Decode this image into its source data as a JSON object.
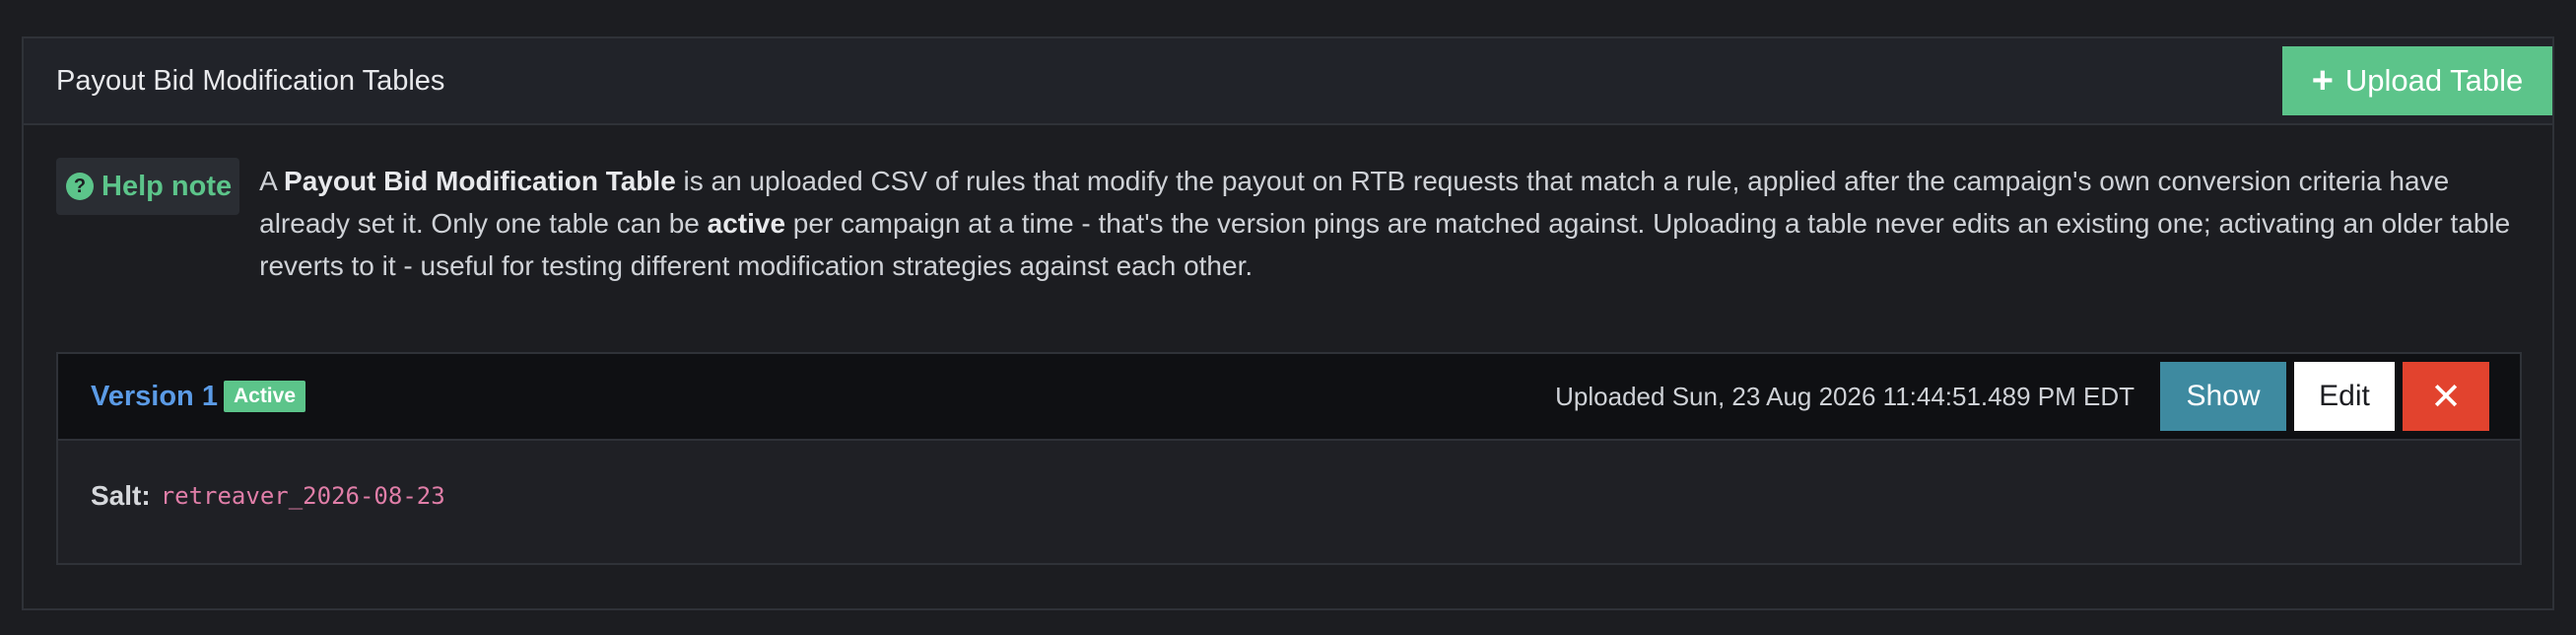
{
  "panel": {
    "title": "Payout Bid Modification Tables",
    "upload_label": "Upload Table",
    "upload_icon": "plus-icon"
  },
  "help": {
    "badge_label": "Help note",
    "badge_icon": "question-circle-icon",
    "text_parts": {
      "p1": "A ",
      "b1": "Payout Bid Modification Table",
      "p2": " is an uploaded CSV of rules that modify the payout on RTB requests that match a rule, applied after the campaign's own conversion criteria have already set it. Only one table can be ",
      "b2": "active",
      "p3": " per campaign at a time - that's the version pings are matched against. Uploading a table never edits an existing one; activating an older table reverts to it - useful for testing different modification strategies against each other."
    }
  },
  "version": {
    "title": "Version 1",
    "badge": "Active",
    "uploaded": "Uploaded Sun, 23 Aug 2026 11:44:51.489 PM EDT",
    "show_label": "Show",
    "edit_label": "Edit",
    "delete_icon": "close-icon",
    "salt_label": "Salt:",
    "salt_value": "retreaver_2026-08-23"
  },
  "colors": {
    "accent_green": "#5cc48a",
    "link_blue": "#5b9be6",
    "show_teal": "#3e8aa0",
    "danger_red": "#e2432e",
    "code_pink": "#e07ea8"
  }
}
